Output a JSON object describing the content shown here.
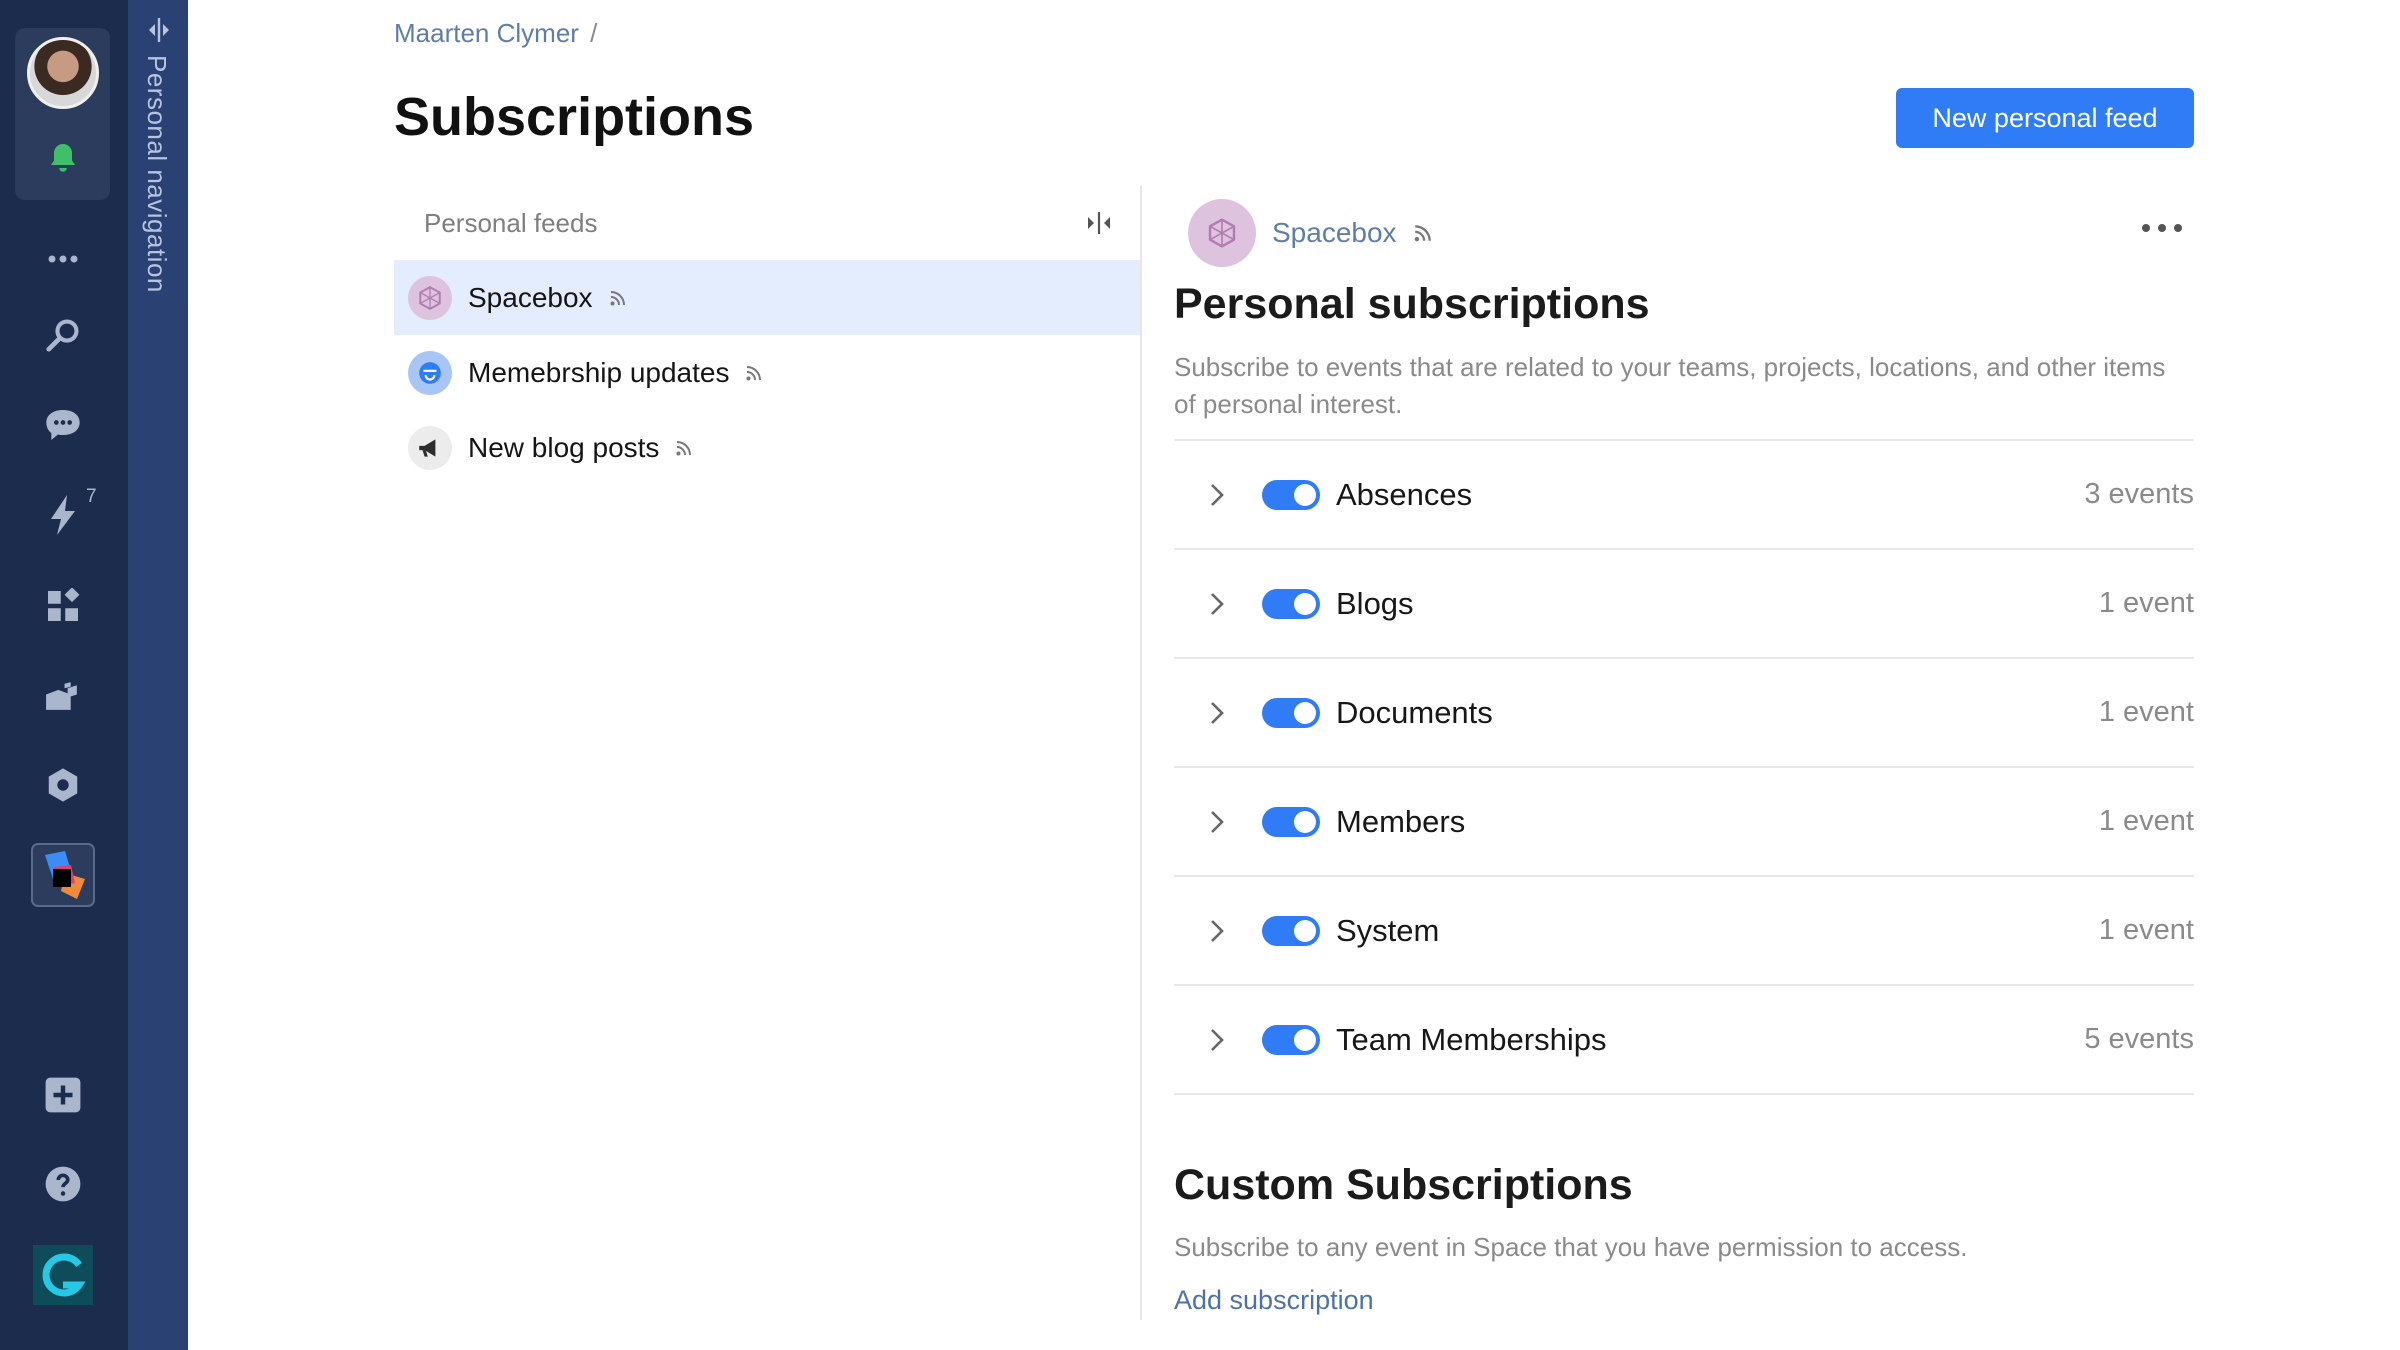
{
  "rail": {
    "items": [
      {
        "icon": "avatar"
      },
      {
        "icon": "bell-icon"
      },
      {
        "icon": "more-icon"
      },
      {
        "icon": "search-icon"
      },
      {
        "icon": "chat-icon"
      },
      {
        "icon": "lightning-icon",
        "badge": "7"
      },
      {
        "icon": "apps-icon"
      },
      {
        "icon": "team-icon"
      },
      {
        "icon": "settings-icon"
      },
      {
        "icon": "jetbrains-icon"
      },
      {
        "icon": "plus-icon"
      },
      {
        "icon": "help-icon"
      },
      {
        "icon": "space-logo-icon"
      }
    ],
    "badge_count": "7"
  },
  "personal_nav": {
    "label": "Personal navigation"
  },
  "breadcrumb": {
    "owner": "Maarten Clymer",
    "separator": "/"
  },
  "page": {
    "title": "Subscriptions",
    "new_feed_button": "New personal feed"
  },
  "feeds": {
    "header": "Personal feeds",
    "items": [
      {
        "label": "Spacebox",
        "active": true
      },
      {
        "label": "Memebrship updates",
        "active": false
      },
      {
        "label": "New blog posts",
        "active": false
      }
    ]
  },
  "detail": {
    "feed_name": "Spacebox",
    "personal_title": "Personal subscriptions",
    "personal_desc": "Subscribe to events that are related to your teams, projects, locations, and other items of personal interest.",
    "subscriptions": [
      {
        "label": "Absences",
        "count": "3 events",
        "enabled": true
      },
      {
        "label": "Blogs",
        "count": "1 event",
        "enabled": true
      },
      {
        "label": "Documents",
        "count": "1 event",
        "enabled": true
      },
      {
        "label": "Members",
        "count": "1 event",
        "enabled": true
      },
      {
        "label": "System",
        "count": "1 event",
        "enabled": true
      },
      {
        "label": "Team Memberships",
        "count": "5 events",
        "enabled": true
      }
    ],
    "custom_title": "Custom Subscriptions",
    "custom_desc": "Subscribe to any event in Space that you have permission to access.",
    "add_subscription": "Add subscription"
  },
  "colors": {
    "rail_bg": "#1c2c4c",
    "pnav_bg": "#2a4173",
    "accent": "#2f7cf6",
    "active_row": "#e3edfd",
    "link": "#5e7ea8"
  }
}
